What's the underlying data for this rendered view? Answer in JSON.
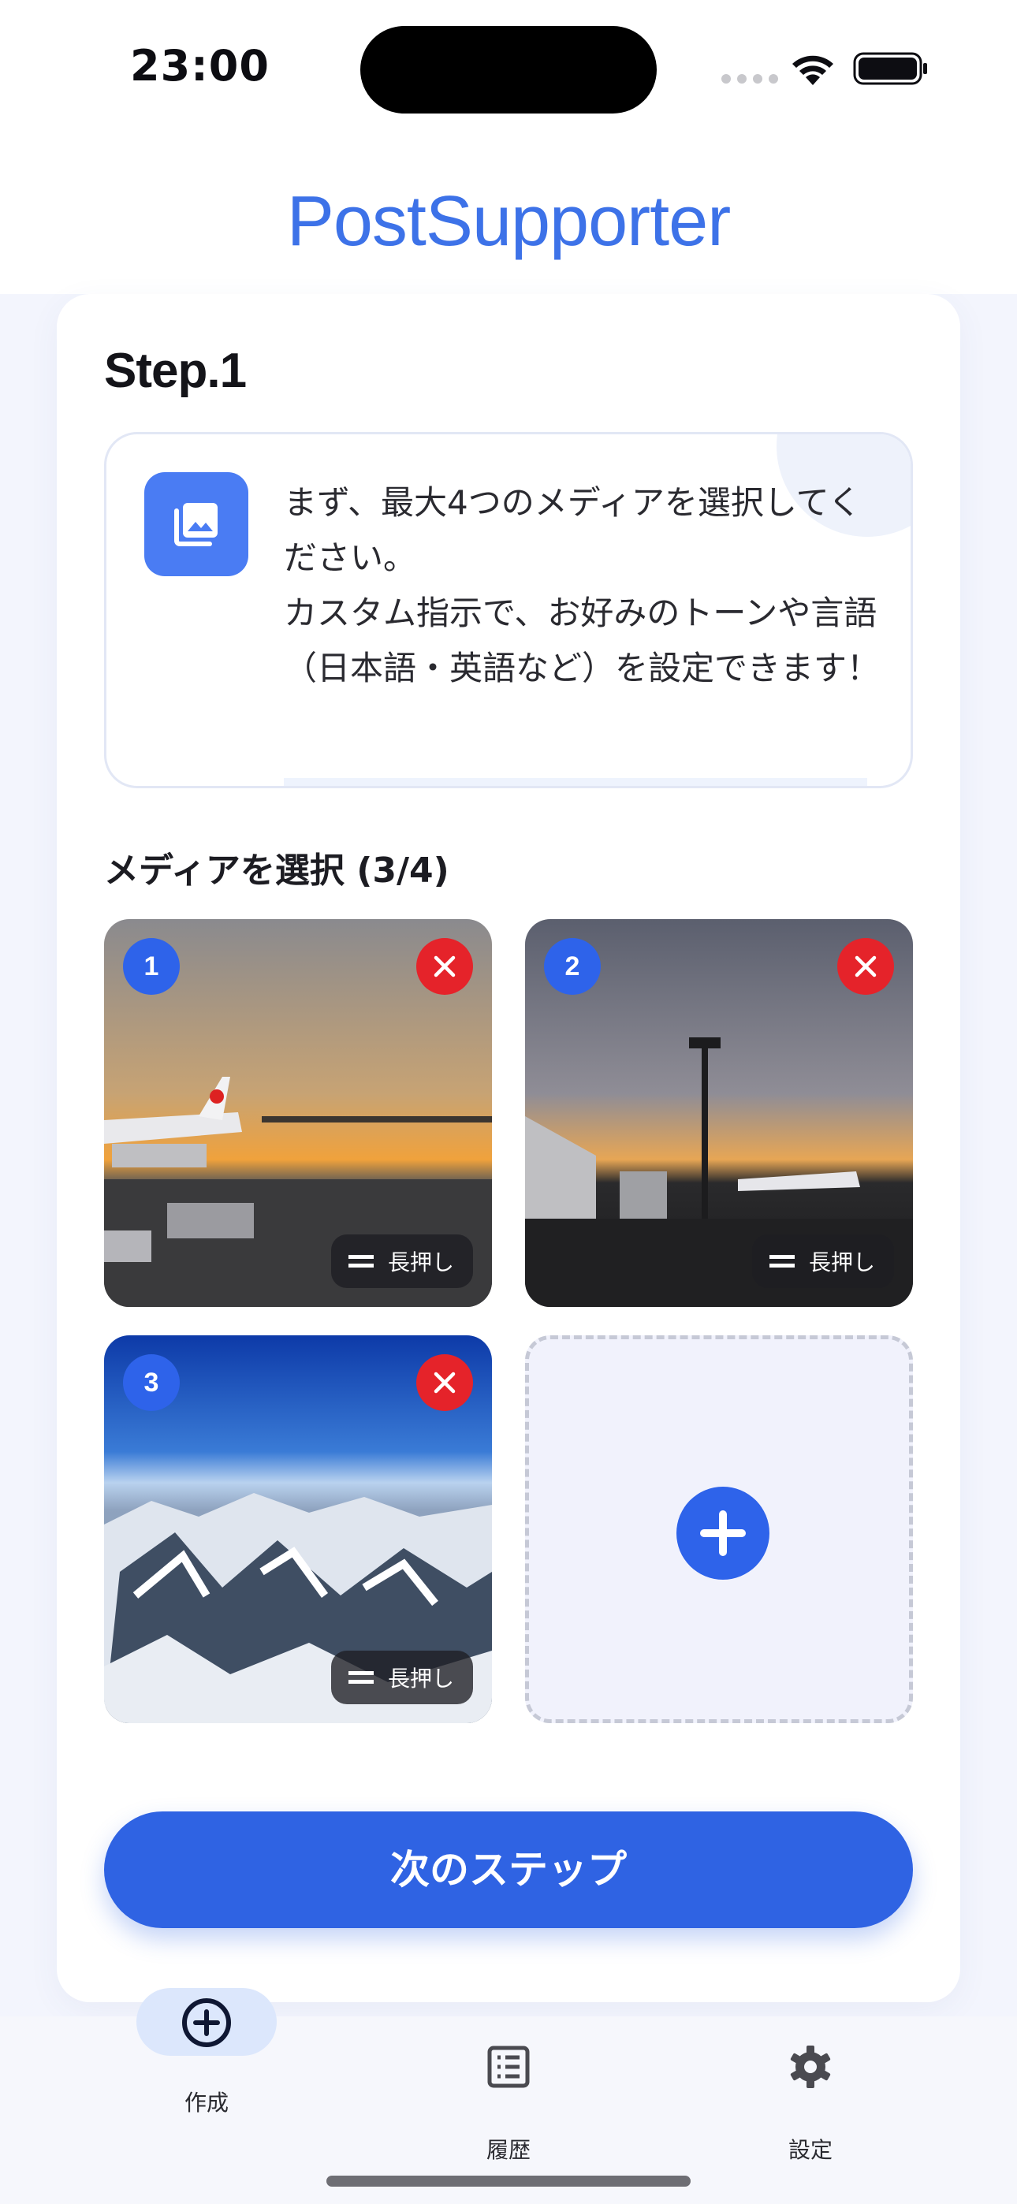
{
  "status_bar": {
    "time": "23:00"
  },
  "header": {
    "title": "PostSupporter"
  },
  "card": {
    "step_title": "Step.1",
    "info_text": "まず、最大4つのメディアを選択してください。\nカスタム指示で、お好みのトーンや言語（日本語・英語など）を設定できます！",
    "media_label": "メディアを選択 (3/4)",
    "media": [
      {
        "number": "1",
        "drag_label": "長押し",
        "description": "airport sunset with airplane"
      },
      {
        "number": "2",
        "drag_label": "長押し",
        "description": "airport apron light tower at dusk"
      },
      {
        "number": "3",
        "drag_label": "長押し",
        "description": "snowy mountains from airplane"
      }
    ],
    "next_button": "次のステップ"
  },
  "tab_bar": {
    "items": [
      {
        "label": "作成",
        "icon": "plus-circle-icon",
        "active": true
      },
      {
        "label": "履歴",
        "icon": "list-icon",
        "active": false
      },
      {
        "label": "設定",
        "icon": "gear-icon",
        "active": false
      }
    ]
  },
  "colors": {
    "accent": "#2f63e3",
    "title": "#3d72e8",
    "remove": "#e5232a",
    "tab_active_bg": "#dce7fc"
  }
}
